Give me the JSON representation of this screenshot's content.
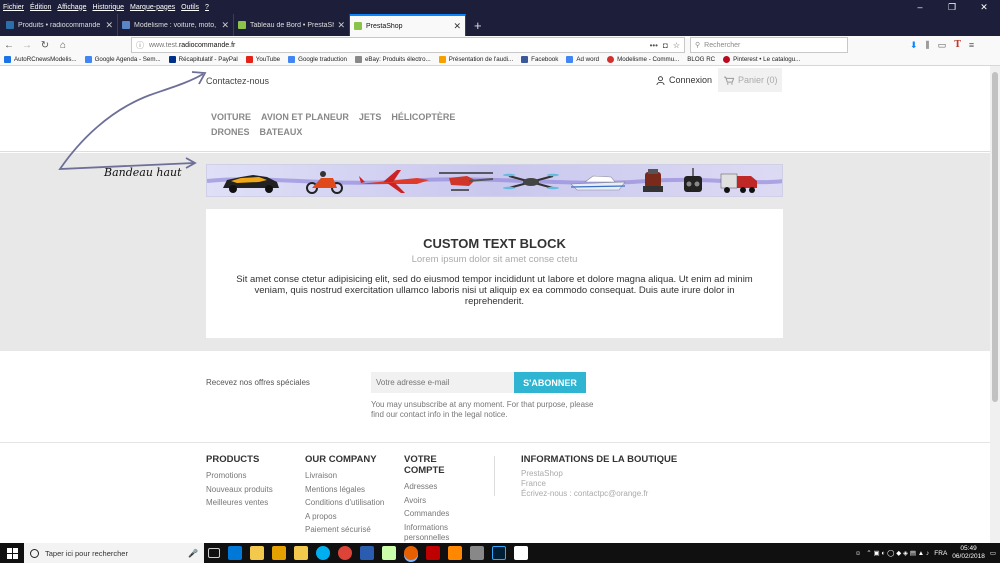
{
  "menubar": [
    "Fichier",
    "Édition",
    "Affichage",
    "Historique",
    "Marque-pages",
    "Outils",
    "?"
  ],
  "tabs": [
    {
      "title": "Produits • radiocommande",
      "color": "#2b6ea8",
      "active": false
    },
    {
      "title": "Modelisme : voiture, moto, ba",
      "color": "#5a86c8",
      "active": false
    },
    {
      "title": "Tableau de Bord • PrestaShop",
      "color": "#8bc34a",
      "active": false
    },
    {
      "title": "PrestaShop",
      "color": "#8bc34a",
      "active": true
    }
  ],
  "url": {
    "prefix": "www.test.",
    "domain": "radiocommande.fr"
  },
  "search_placeholder": "Rechercher",
  "bookmarks": [
    {
      "label": "AutoRCnewsModelis...",
      "color": "#1a73e8"
    },
    {
      "label": "Google Agenda - Sem...",
      "color": "#4285f4"
    },
    {
      "label": "Récapitulatif - PayPal",
      "color": "#003087"
    },
    {
      "label": "YouTube",
      "color": "#e62117"
    },
    {
      "label": "Google traduction",
      "color": "#4285f4"
    },
    {
      "label": "eBay: Produits électro...",
      "color": "#888888"
    },
    {
      "label": "Présentation de l'audi...",
      "color": "#f4a100"
    },
    {
      "label": "Facebook",
      "color": "#3b5998"
    },
    {
      "label": "Ad word",
      "color": "#4285f4"
    },
    {
      "label": "Modelisme - Commu...",
      "color": "#d32f2f"
    },
    {
      "label": "BLOG RC",
      "color": "#f9f9fa"
    },
    {
      "label": "Pinterest • Le catalogu...",
      "color": "#bd081c"
    }
  ],
  "header": {
    "contact": "Contactez-nous",
    "login": "Connexion",
    "cart": "Panier (0)"
  },
  "nav": [
    "VOITURE",
    "AVION ET PLANEUR",
    "JETS",
    "HÉLICOPTÈRE",
    "DRONES",
    "BATEAUX"
  ],
  "annotation": "Bandeau haut",
  "text_block": {
    "title": "CUSTOM TEXT BLOCK",
    "subtitle": "Lorem ipsum dolor sit amet conse ctetu",
    "body": "Sit amet conse ctetur adipisicing elit, sed do eiusmod tempor incididunt ut labore et dolore magna aliqua. Ut enim ad minim veniam, quis nostrud exercitation ullamco laboris nisi ut aliquip ex ea commodo consequat. Duis aute irure dolor in reprehenderit."
  },
  "newsletter": {
    "label": "Recevez nos offres spéciales",
    "placeholder": "Votre adresse e-mail",
    "button": "S'ABONNER",
    "note": "You may unsubscribe at any moment. For that purpose, please find our contact info in the legal notice."
  },
  "footer": {
    "products": {
      "title": "PRODUCTS",
      "links": [
        "Promotions",
        "Nouveaux produits",
        "Meilleures ventes"
      ]
    },
    "company": {
      "title": "OUR COMPANY",
      "links": [
        "Livraison",
        "Mentions légales",
        "Conditions d'utilisation",
        "A propos",
        "Paiement sécurisé"
      ]
    },
    "account": {
      "title": "VOTRE COMPTE",
      "links": [
        "Adresses",
        "Avoirs",
        "Commandes",
        "Informations personnelles"
      ]
    },
    "info": {
      "title": "INFORMATIONS DE LA BOUTIQUE",
      "lines": [
        "PrestaShop",
        "France",
        "Écrivez-nous : contactpc@orange.fr"
      ]
    }
  },
  "taskbar": {
    "search": "Taper ici pour rechercher",
    "lang": "FRA",
    "time": "05:49",
    "date": "06/02/2018"
  }
}
